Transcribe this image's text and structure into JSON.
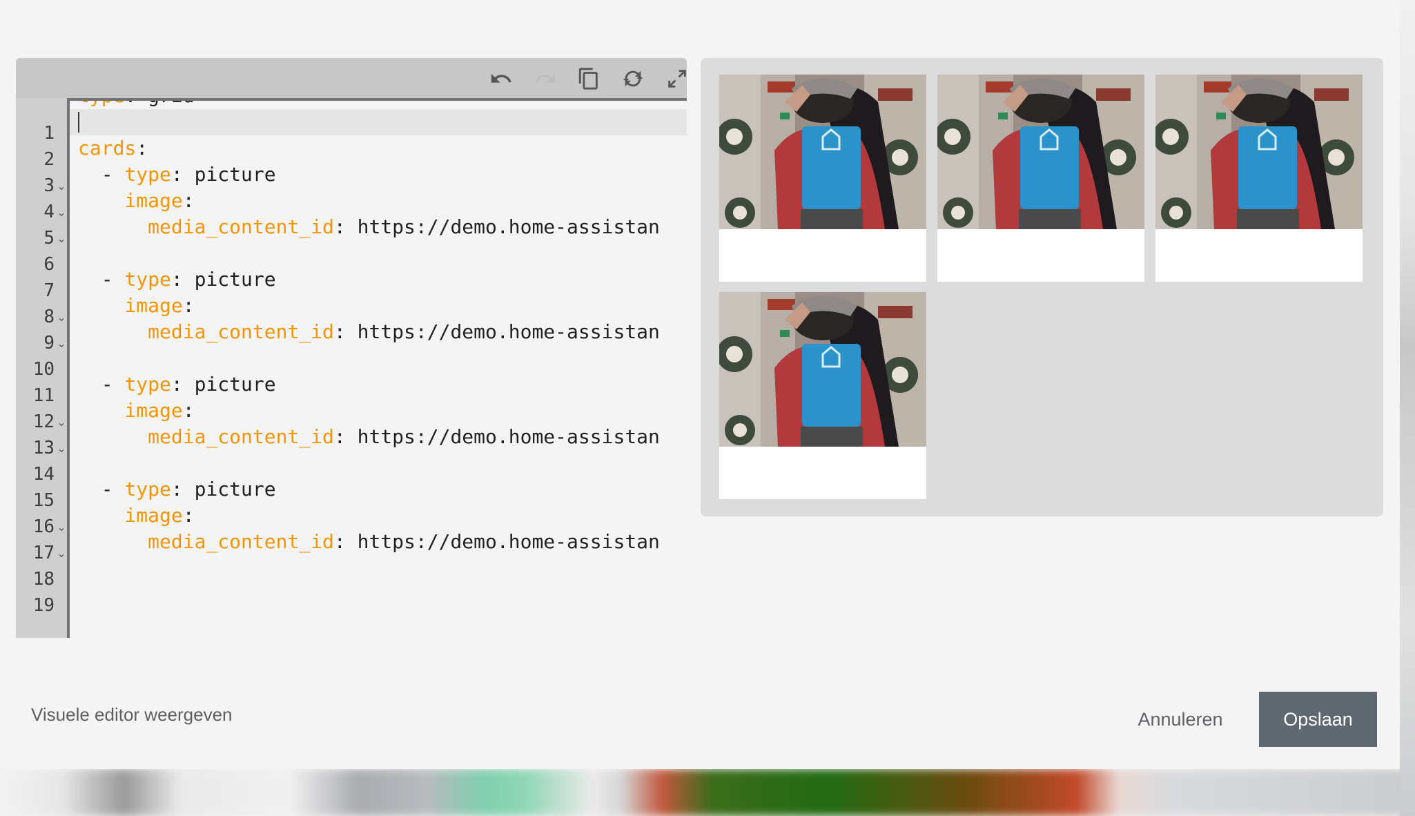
{
  "editor": {
    "toolbar": {
      "undo": "undo-icon",
      "redo": "redo-icon",
      "copy": "copy-icon",
      "refresh": "refresh-icon",
      "fullscreen": "fullscreen-icon"
    },
    "lines": [
      {
        "n": "1",
        "indent": "",
        "dash": false,
        "key": "type",
        "value": " grid",
        "fold": false
      },
      {
        "n": "2",
        "indent": "",
        "dash": false,
        "key": "",
        "value": "",
        "fold": false,
        "active": true
      },
      {
        "n": "3",
        "indent": "",
        "dash": false,
        "key": "cards",
        "value": "",
        "fold": true
      },
      {
        "n": "4",
        "indent": "  ",
        "dash": true,
        "key": "type",
        "value": " picture",
        "fold": true
      },
      {
        "n": "5",
        "indent": "    ",
        "dash": false,
        "key": "image",
        "value": "",
        "fold": true
      },
      {
        "n": "6",
        "indent": "      ",
        "dash": false,
        "key": "media_content_id",
        "value": " https://demo.home-assistan",
        "fold": false
      },
      {
        "n": "7",
        "indent": "",
        "dash": false,
        "key": "",
        "value": "",
        "fold": false
      },
      {
        "n": "8",
        "indent": "  ",
        "dash": true,
        "key": "type",
        "value": " picture",
        "fold": true
      },
      {
        "n": "9",
        "indent": "    ",
        "dash": false,
        "key": "image",
        "value": "",
        "fold": true
      },
      {
        "n": "10",
        "indent": "      ",
        "dash": false,
        "key": "media_content_id",
        "value": " https://demo.home-assistan",
        "fold": false
      },
      {
        "n": "11",
        "indent": "",
        "dash": false,
        "key": "",
        "value": "",
        "fold": false
      },
      {
        "n": "12",
        "indent": "  ",
        "dash": true,
        "key": "type",
        "value": " picture",
        "fold": true
      },
      {
        "n": "13",
        "indent": "    ",
        "dash": false,
        "key": "image",
        "value": "",
        "fold": true
      },
      {
        "n": "14",
        "indent": "      ",
        "dash": false,
        "key": "media_content_id",
        "value": " https://demo.home-assistan",
        "fold": false
      },
      {
        "n": "15",
        "indent": "",
        "dash": false,
        "key": "",
        "value": "",
        "fold": false
      },
      {
        "n": "16",
        "indent": "  ",
        "dash": true,
        "key": "type",
        "value": " picture",
        "fold": true
      },
      {
        "n": "17",
        "indent": "    ",
        "dash": false,
        "key": "image",
        "value": "",
        "fold": true
      },
      {
        "n": "18",
        "indent": "      ",
        "dash": false,
        "key": "media_content_id",
        "value": " https://demo.home-assistan",
        "fold": false
      },
      {
        "n": "19",
        "indent": "",
        "dash": false,
        "key": "",
        "value": "",
        "fold": false
      }
    ]
  },
  "preview": {
    "cards": [
      {
        "image": "person-hat-red-jacket-photo"
      },
      {
        "image": "person-hat-red-jacket-photo"
      },
      {
        "image": "person-hat-red-jacket-photo"
      },
      {
        "image": "person-hat-red-jacket-photo"
      }
    ]
  },
  "footer": {
    "visual_editor_label": "Visuele editor weergeven",
    "cancel_label": "Annuleren",
    "save_label": "Opslaan"
  },
  "colors": {
    "yaml_key": "#f0950a",
    "save_button": "#5f6770"
  }
}
